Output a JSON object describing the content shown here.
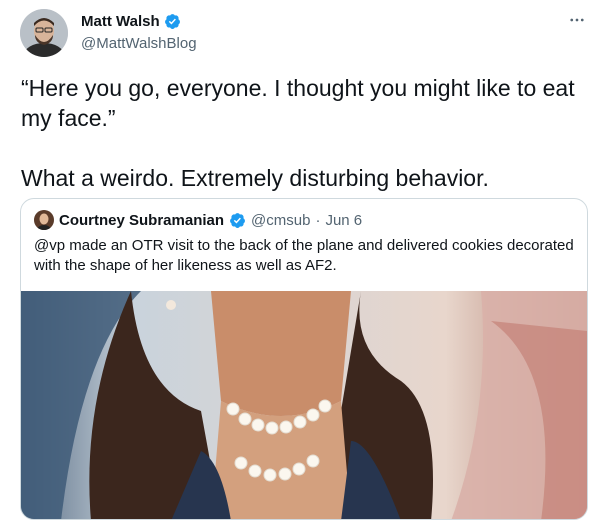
{
  "tweet": {
    "author": {
      "name": "Matt Walsh",
      "handle": "@MattWalshBlog",
      "verified": true,
      "avatar_icon": "avatar-portrait-icon"
    },
    "more_icon": "more-options-icon",
    "text": "“Here you go, everyone. I thought you might like to eat my face.”\n\nWhat a weirdo. Extremely disturbing behavior."
  },
  "quoted": {
    "author": {
      "name": "Courtney Subramanian",
      "handle": "@cmsub",
      "verified": true
    },
    "separator": "·",
    "date": "Jun 6",
    "text": "@vp made an OTR visit to the back of the plane and delivered cookies decorated with the shape of her likeness as well as AF2.",
    "media_icon": "cookie-photo-image"
  },
  "colors": {
    "verified_blue": "#1d9bf0",
    "text_primary": "#0f1419",
    "text_secondary": "#536471",
    "border": "#cfd9de"
  }
}
